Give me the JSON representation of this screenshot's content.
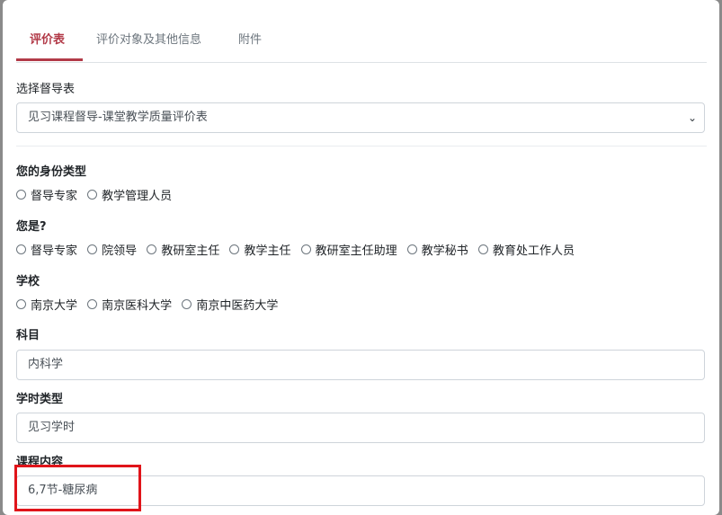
{
  "tabs": [
    {
      "label": "评价表",
      "active": true
    },
    {
      "label": "评价对象及其他信息",
      "active": false
    },
    {
      "label": "附件",
      "active": false
    }
  ],
  "form_select": {
    "label": "选择督导表",
    "value": "见习课程督导-课堂教学质量评价表"
  },
  "identity": {
    "label": "您的身份类型",
    "options": [
      "督导专家",
      "教学管理人员"
    ]
  },
  "role": {
    "label": "您是?",
    "options": [
      "督导专家",
      "院领导",
      "教研室主任",
      "教学主任",
      "教研室主任助理",
      "教学秘书",
      "教育处工作人员"
    ]
  },
  "school": {
    "label": "学校",
    "options": [
      "南京大学",
      "南京医科大学",
      "南京中医药大学"
    ]
  },
  "subject": {
    "label": "科目",
    "value": "内科学"
  },
  "hour_type": {
    "label": "学时类型",
    "value": "见习学时"
  },
  "course_content": {
    "label": "课程内容",
    "value": "6,7节-糖尿病"
  },
  "colors": {
    "accent": "#b23a48",
    "highlight": "#e0141a"
  }
}
